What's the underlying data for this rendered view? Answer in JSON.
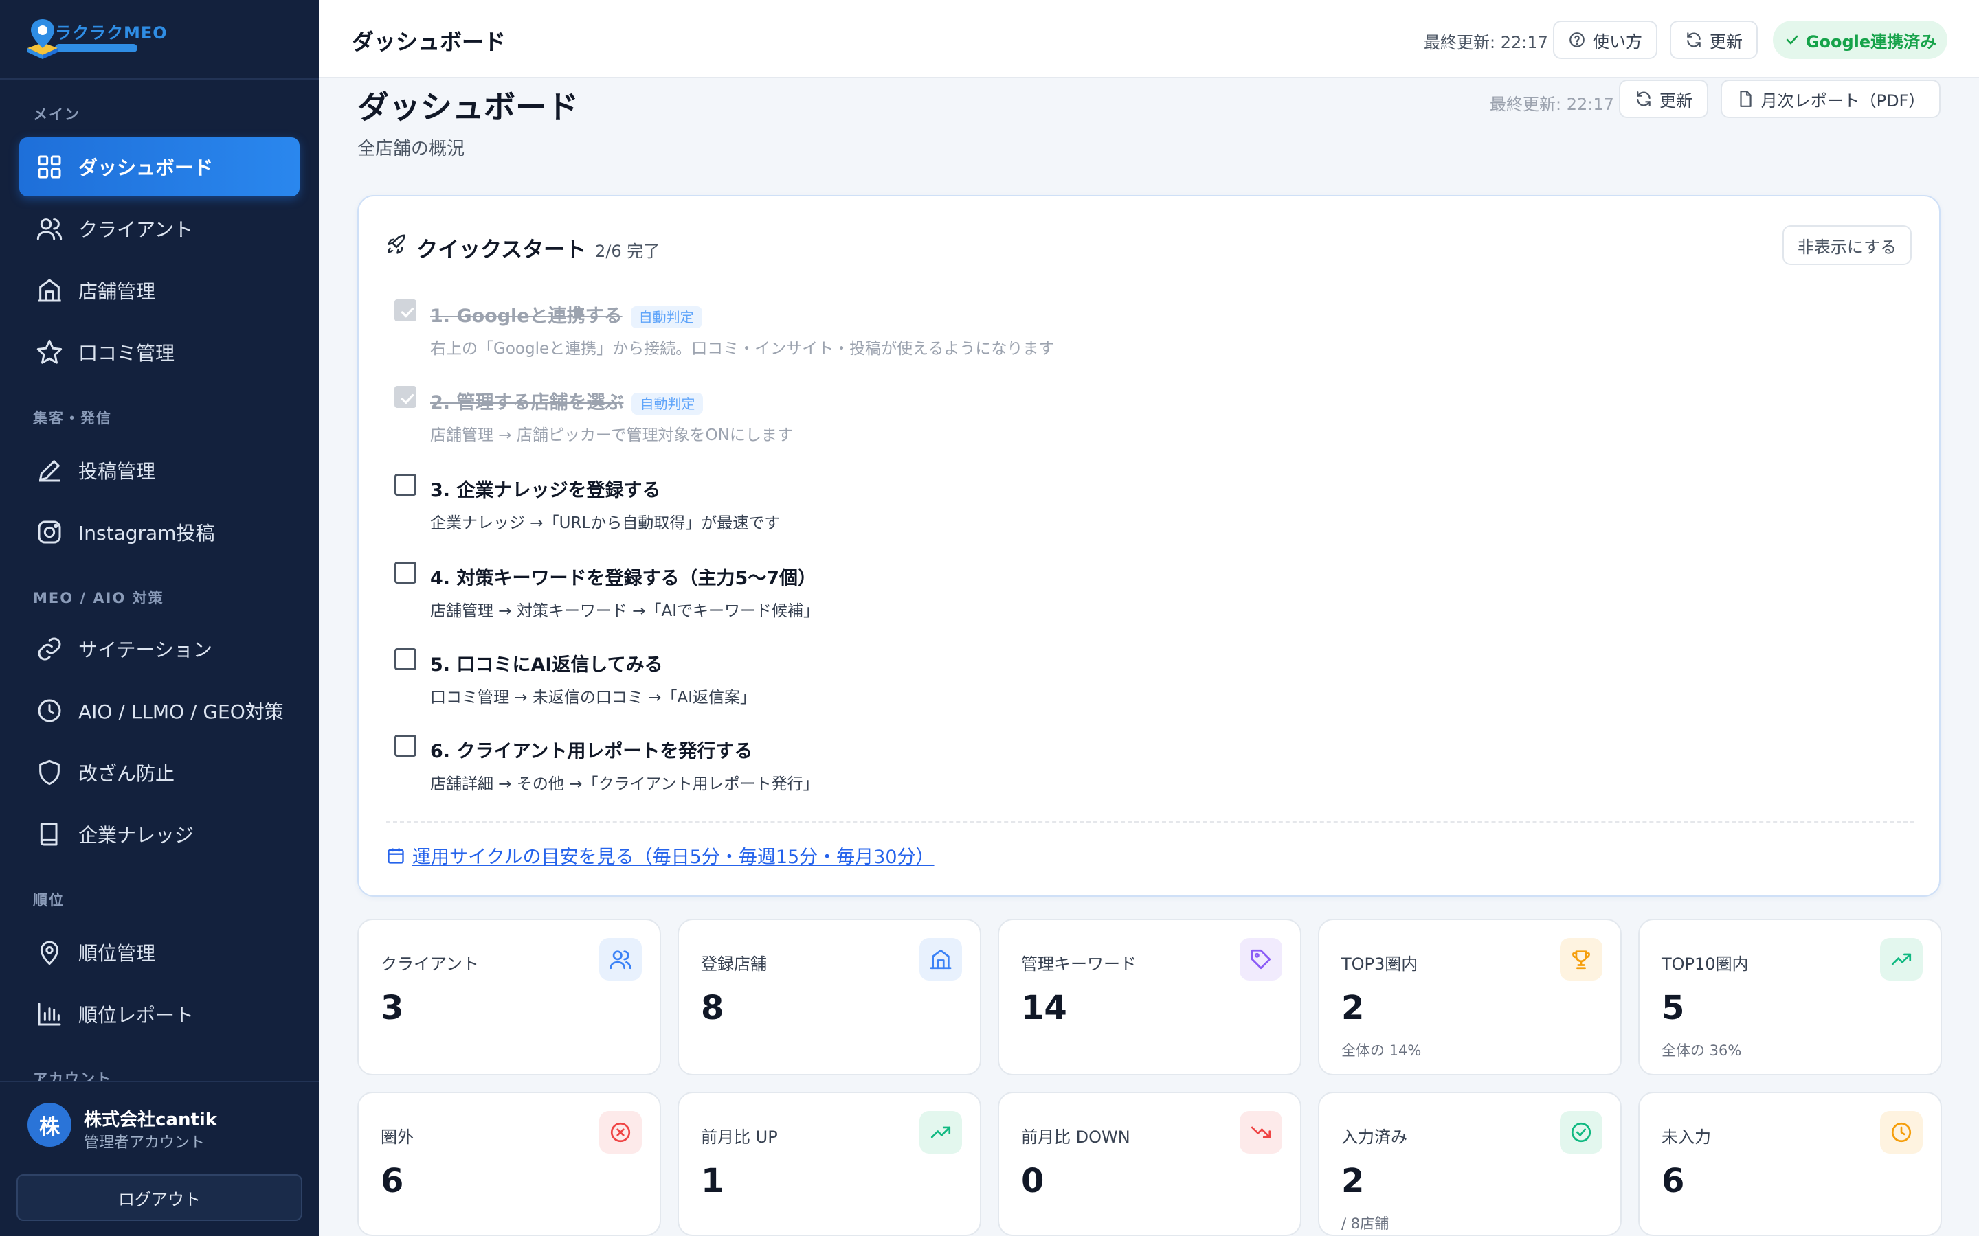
{
  "brand": {
    "name": "ラクラクMEO",
    "accent": "#1e6fd9"
  },
  "sidebar": {
    "sections": [
      {
        "label": "メイン"
      },
      {
        "label": "集客・発信"
      },
      {
        "label": "MEO / AIO 対策"
      },
      {
        "label": "順位"
      },
      {
        "label": "アカウント"
      }
    ],
    "items": [
      {
        "label": "ダッシュボード",
        "icon": "grid-icon",
        "active": true
      },
      {
        "label": "クライアント",
        "icon": "users-icon"
      },
      {
        "label": "店舗管理",
        "icon": "building-icon"
      },
      {
        "label": "口コミ管理",
        "icon": "star-icon"
      },
      {
        "label": "投稿管理",
        "icon": "pencil-icon"
      },
      {
        "label": "Instagram投稿",
        "icon": "instagram-icon"
      },
      {
        "label": "サイテーション",
        "icon": "link-icon"
      },
      {
        "label": "AIO / LLMO / GEO対策",
        "icon": "clock-icon"
      },
      {
        "label": "改ざん防止",
        "icon": "shield-icon"
      },
      {
        "label": "企業ナレッジ",
        "icon": "book-icon"
      },
      {
        "label": "順位管理",
        "icon": "map-pin-icon"
      },
      {
        "label": "順位レポート",
        "icon": "bar-chart-icon"
      }
    ],
    "user": {
      "avatar": "株",
      "name": "株式会社cantik",
      "role": "管理者アカウント"
    },
    "logout": "ログアウト"
  },
  "topbar": {
    "title": "ダッシュボード",
    "last_updated": "最終更新: 22:17",
    "help": "使い方",
    "refresh": "更新",
    "google_status": "Google連携済み"
  },
  "page": {
    "title": "ダッシュボード",
    "subtitle": "全店舗の概況",
    "last_updated": "最終更新: 22:17",
    "refresh": "更新",
    "report": "月次レポート（PDF）"
  },
  "quickstart": {
    "title": "クイックスタート",
    "progress": "2/6 完了",
    "hide": "非表示にする",
    "tasks": [
      {
        "title": "1. Googleと連携する",
        "tag": "自動判定",
        "desc": "右上の「Googleと連携」から接続。口コミ・インサイト・投稿が使えるようになります",
        "done": true
      },
      {
        "title": "2. 管理する店舗を選ぶ",
        "tag": "自動判定",
        "desc": "店舗管理 → 店舗ピッカーで管理対象をONにします",
        "done": true
      },
      {
        "title": "3. 企業ナレッジを登録する",
        "desc": "企業ナレッジ →「URLから自動取得」が最速です",
        "done": false
      },
      {
        "title": "4. 対策キーワードを登録する（主力5〜7個）",
        "desc": "店舗管理 → 対策キーワード →「AIでキーワード候補」",
        "done": false
      },
      {
        "title": "5. 口コミにAI返信してみる",
        "desc": "口コミ管理 → 未返信の口コミ →「AI返信案」",
        "done": false
      },
      {
        "title": "6. クライアント用レポートを発行する",
        "desc": "店舗詳細 → その他 →「クライアント用レポート発行」",
        "done": false
      }
    ],
    "cycle_link": "運用サイクルの目安を見る（毎日5分・毎週15分・毎月30分）"
  },
  "stats": [
    {
      "label": "クライアント",
      "value": "3",
      "sub": "",
      "icon": "users-icon",
      "color": "#3b82f6",
      "bg": "#e8f1fd"
    },
    {
      "label": "登録店舗",
      "value": "8",
      "sub": "",
      "icon": "building-icon",
      "color": "#3b82f6",
      "bg": "#e8f1fd"
    },
    {
      "label": "管理キーワード",
      "value": "14",
      "sub": "",
      "icon": "tag-icon",
      "color": "#8b5cf6",
      "bg": "#f1ebfd"
    },
    {
      "label": "TOP3圏内",
      "value": "2",
      "sub": "全体の 14%",
      "icon": "trophy-icon",
      "color": "#f59e0b",
      "bg": "#fef3e0"
    },
    {
      "label": "TOP10圏内",
      "value": "5",
      "sub": "全体の 36%",
      "icon": "trend-up-icon",
      "color": "#10b981",
      "bg": "#e3f7ee"
    },
    {
      "label": "圏外",
      "value": "6",
      "sub": "",
      "icon": "x-circle-icon",
      "color": "#ef4444",
      "bg": "#fdeaea"
    },
    {
      "label": "前月比 UP",
      "value": "1",
      "sub": "",
      "icon": "trend-up-icon",
      "color": "#10b981",
      "bg": "#e3f7ee"
    },
    {
      "label": "前月比 DOWN",
      "value": "0",
      "sub": "",
      "icon": "trend-down-icon",
      "color": "#ef4444",
      "bg": "#fdeaea"
    },
    {
      "label": "入力済み",
      "value": "2",
      "sub": "/ 8店舗",
      "icon": "check-circle-icon",
      "color": "#10b981",
      "bg": "#e3f7ee"
    },
    {
      "label": "未入力",
      "value": "6",
      "sub": "",
      "icon": "clock-icon",
      "color": "#f59e0b",
      "bg": "#fef3e0"
    }
  ]
}
